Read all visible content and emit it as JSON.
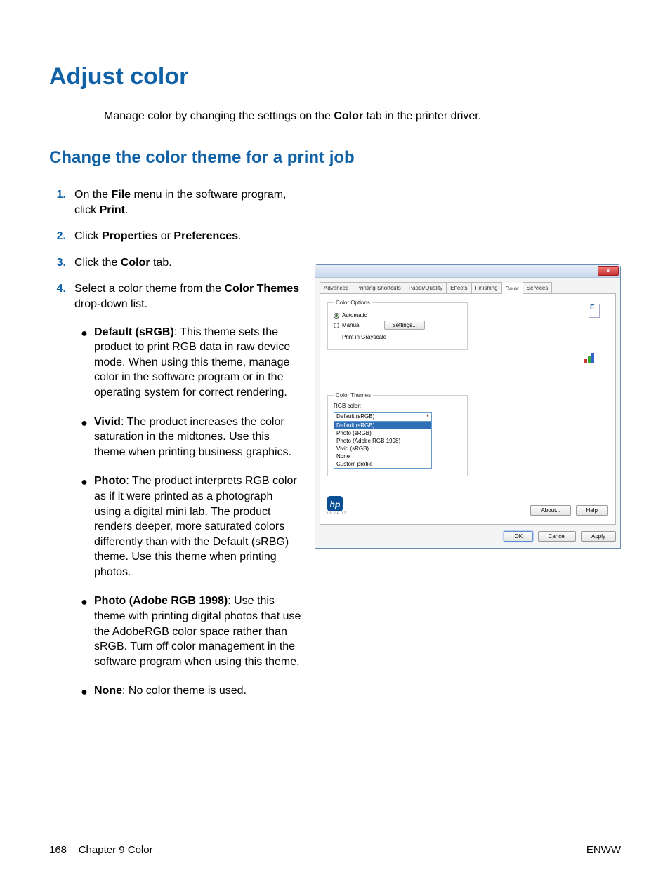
{
  "heading": "Adjust color",
  "intro_pre": "Manage color by changing the settings on the ",
  "intro_bold": "Color",
  "intro_post": " tab in the printer driver.",
  "subheading": "Change the color theme for a print job",
  "steps": {
    "s1_a": "On the ",
    "s1_b": "File",
    "s1_c": " menu in the software program, click ",
    "s1_d": "Print",
    "s1_e": ".",
    "s2_a": "Click ",
    "s2_b": "Properties",
    "s2_c": " or ",
    "s2_d": "Preferences",
    "s2_e": ".",
    "s3_a": "Click the ",
    "s3_b": "Color",
    "s3_c": " tab.",
    "s4_a": "Select a color theme from the ",
    "s4_b": "Color Themes",
    "s4_c": " drop-down list."
  },
  "bullets": {
    "b1_t": "Default (sRGB)",
    "b1_r": ": This theme sets the product to print RGB data in raw device mode. When using this theme, manage color in the software program or in the operating system for correct rendering.",
    "b2_t": "Vivid",
    "b2_r": ": The product increases the color saturation in the midtones. Use this theme when printing business graphics.",
    "b3_t": "Photo",
    "b3_r": ": The product interprets RGB color as if it were printed as a photograph using a digital mini lab. The product renders deeper, more saturated colors differently than with the Default (sRBG) theme. Use this theme when printing photos.",
    "b4_t": "Photo (Adobe RGB 1998)",
    "b4_r": ": Use this theme with printing digital photos that use the AdobeRGB color space rather than sRGB. Turn off color management in the software program when using this theme.",
    "b5_t": "None",
    "b5_r": ": No color theme is used."
  },
  "dialog": {
    "tabs": [
      "Advanced",
      "Printing Shortcuts",
      "Paper/Quality",
      "Effects",
      "Finishing",
      "Color",
      "Services"
    ],
    "active_tab": "Color",
    "color_options_legend": "Color Options",
    "automatic": "Automatic",
    "manual": "Manual",
    "settings_btn": "Settings...",
    "grayscale": "Print in Grayscale",
    "color_themes_legend": "Color Themes",
    "rgb_label": "RGB color:",
    "combo_value": "Default (sRGB)",
    "options": [
      "Default (sRGB)",
      "Photo (sRGB)",
      "Photo (Adobe RGB 1998)",
      "Vivid (sRGB)",
      "None",
      "Custom profile"
    ],
    "about": "About...",
    "help": "Help",
    "ok": "OK",
    "cancel": "Cancel",
    "apply": "Apply",
    "hp": "hp",
    "invent": "invent",
    "e": "E"
  },
  "footer": {
    "page": "168",
    "chapter": "Chapter 9   Color",
    "right": "ENWW"
  },
  "nums": {
    "n1": "1.",
    "n2": "2.",
    "n3": "3.",
    "n4": "4."
  },
  "dot": "●"
}
